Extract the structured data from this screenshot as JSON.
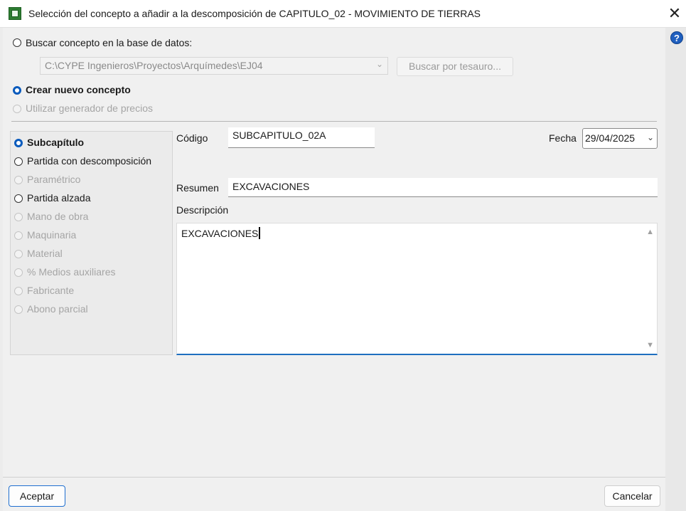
{
  "window": {
    "title": "Selección del concepto a añadir a la descomposición de CAPITULO_02 - MOVIMIENTO DE TIERRAS",
    "close_glyph": "✕",
    "help_glyph": "?"
  },
  "source": {
    "search_db_label": "Buscar concepto en la base de datos:",
    "path_value": "C:\\CYPE Ingenieros\\Proyectos\\Arquímedes\\EJ04",
    "thesaurus_button": "Buscar por tesauro...",
    "create_new_label": "Crear nuevo concepto",
    "price_generator_label": "Utilizar generador de precios",
    "selected": "create_new"
  },
  "concept_types": {
    "selected": "Subcapítulo",
    "items": [
      {
        "label": "Subcapítulo",
        "enabled": true
      },
      {
        "label": "Partida con descomposición",
        "enabled": true
      },
      {
        "label": "Paramétrico",
        "enabled": false
      },
      {
        "label": "Partida alzada",
        "enabled": true
      },
      {
        "label": "Mano de obra",
        "enabled": false
      },
      {
        "label": "Maquinaria",
        "enabled": false
      },
      {
        "label": "Material",
        "enabled": false
      },
      {
        "label": "% Medios auxiliares",
        "enabled": false
      },
      {
        "label": "Fabricante",
        "enabled": false
      },
      {
        "label": "Abono parcial",
        "enabled": false
      }
    ]
  },
  "form": {
    "code_label": "Código",
    "code_value": "SUBCAPITULO_02A",
    "date_label": "Fecha",
    "date_value": "29/04/2025",
    "summary_label": "Resumen",
    "summary_value": "EXCAVACIONES",
    "description_label": "Descripción",
    "description_value": "EXCAVACIONES"
  },
  "footer": {
    "accept_button": "Aceptar",
    "cancel_button": "Cancelar"
  },
  "colors": {
    "accent": "#0a5bbd",
    "focus_underline": "#1e6fc0"
  }
}
